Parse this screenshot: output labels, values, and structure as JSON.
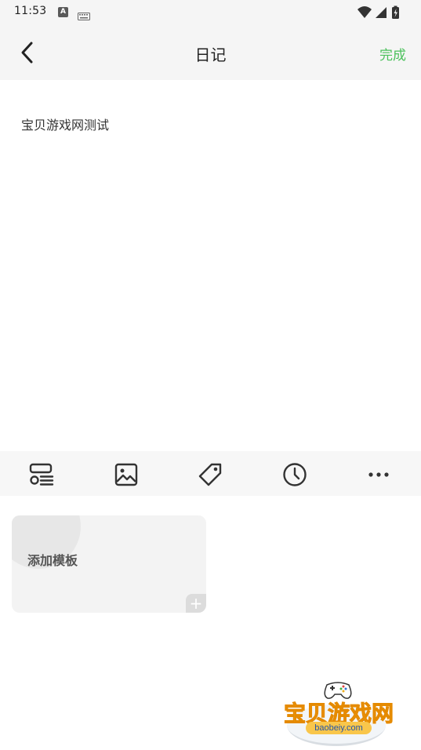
{
  "status_bar": {
    "time": "11:53",
    "a_icon_letter": "A",
    "icons": [
      "a-notification-icon",
      "keyboard-icon",
      "wifi-icon",
      "cell-signal-icon",
      "battery-charging-icon"
    ]
  },
  "header": {
    "title": "日记",
    "done_label": "完成",
    "back_icon": "chevron-left-icon"
  },
  "editor": {
    "text": "宝贝游戏网测试"
  },
  "toolbar": {
    "tools": [
      {
        "name": "template-tool",
        "icon": "template-list-icon"
      },
      {
        "name": "image-tool",
        "icon": "image-icon"
      },
      {
        "name": "tag-tool",
        "icon": "tag-icon"
      },
      {
        "name": "time-tool",
        "icon": "clock-icon"
      },
      {
        "name": "more-tool",
        "icon": "more-dots-icon"
      }
    ]
  },
  "templates": {
    "add_label": "添加模板",
    "plus_symbol": "+"
  },
  "watermark": {
    "brand": "宝贝游戏网",
    "url": "baobeiy.com"
  },
  "colors": {
    "accent_green": "#4cc15c",
    "header_bg": "#f5f5f5",
    "toolbar_bg": "#f7f7f7",
    "card_bg": "#f3f3f3",
    "watermark_orange": "#f5a623"
  }
}
